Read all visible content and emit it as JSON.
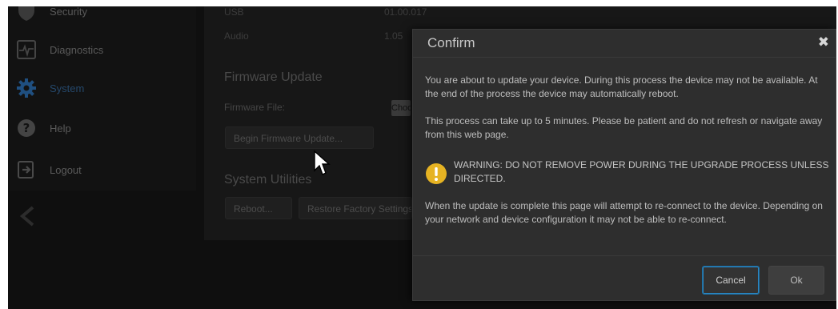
{
  "sidebar": {
    "items": [
      {
        "label": "Security",
        "icon": "shield-icon"
      },
      {
        "label": "Diagnostics",
        "icon": "pulse-icon"
      },
      {
        "label": "System",
        "icon": "gear-icon",
        "active": true
      },
      {
        "label": "Help",
        "icon": "help-icon"
      },
      {
        "label": "Logout",
        "icon": "logout-icon"
      }
    ],
    "collapse_icon": "chevron-left-icon"
  },
  "main": {
    "versions": [
      {
        "label": "USB",
        "value": "01.00.017"
      },
      {
        "label": "Audio",
        "value": "1.05"
      }
    ],
    "firmware": {
      "title": "Firmware Update",
      "file_label": "Firmware File:",
      "choose_label": "Choose",
      "begin_label": "Begin Firmware Update..."
    },
    "utilities": {
      "title": "System Utilities",
      "reboot_label": "Reboot...",
      "restore_label": "Restore Factory Settings"
    }
  },
  "modal": {
    "title": "Confirm",
    "close_icon": "close-icon",
    "paragraph1": "You are about to update your device. During this process the device may not be available. At the end of the process the device may automatically reboot.",
    "paragraph2": "This process can take up to 5 minutes. Please be patient and do not refresh or navigate away from this web page.",
    "warning": "WARNING: DO NOT REMOVE POWER DURING THE UPGRADE PROCESS UNLESS DIRECTED.",
    "paragraph3": "When the update is complete this page will attempt to re-connect to the device. Depending on your network and device configuration it may not be able to re-connect.",
    "cancel_label": "Cancel",
    "ok_label": "Ok"
  },
  "colors": {
    "accent_active": "#25486b",
    "cancel_border": "#2a86c2",
    "warning": "#e6b323"
  }
}
